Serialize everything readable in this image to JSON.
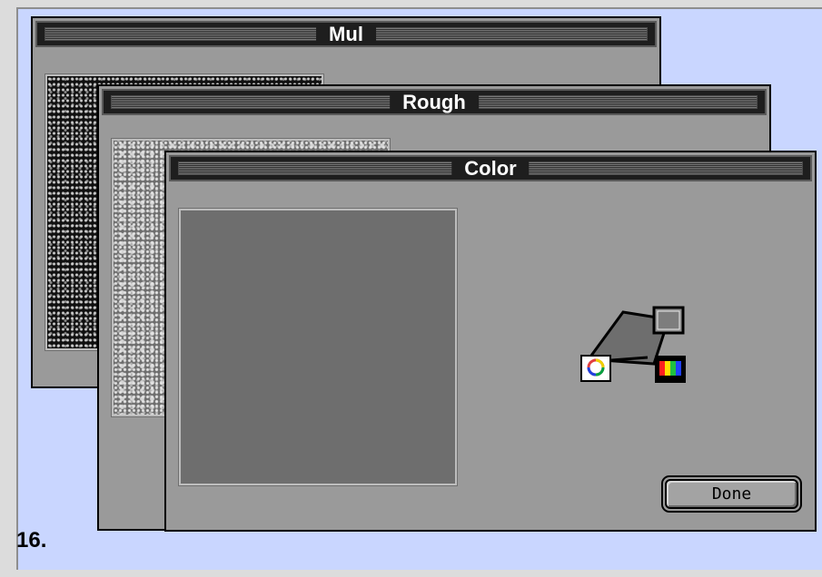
{
  "windows": {
    "mul": {
      "title": "Mul"
    },
    "rough": {
      "title": "Rough"
    },
    "color": {
      "title": "Color",
      "done_label": "Done",
      "icons": [
        "color-wheel-icon",
        "color-spectrum-icon",
        "color-swatch-icon"
      ]
    }
  },
  "caption": "16.",
  "colors": {
    "desktop": "#c9d6ff",
    "window_bg": "#9a9a9a",
    "preview": "#6e6e6e",
    "titlebar": "#1e1e1e"
  }
}
